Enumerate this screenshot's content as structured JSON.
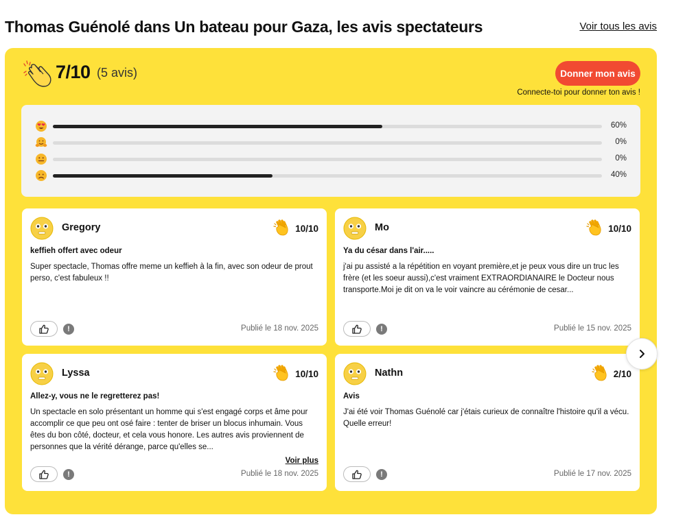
{
  "header": {
    "title": "Thomas Guénolé dans Un bateau pour Gaza, les avis spectateurs",
    "see_all": "Voir tous les avis"
  },
  "summary": {
    "score": "7/10",
    "count": "(5 avis)",
    "give_review": "Donner mon avis",
    "connect_note": "Connecte-toi pour donner ton avis !"
  },
  "distribution": [
    {
      "emoji": "heart-eyes-emoji",
      "percent": 60,
      "label": "60%"
    },
    {
      "emoji": "hugging-emoji",
      "percent": 0,
      "label": "0%"
    },
    {
      "emoji": "neutral-face-emoji",
      "percent": 0,
      "label": "0%"
    },
    {
      "emoji": "disappointed-face-emoji",
      "percent": 40,
      "label": "40%"
    }
  ],
  "reviews": [
    {
      "author": "Gregory",
      "rating": "10/10",
      "title": "keffieh offert avec odeur",
      "body": "Super spectacle, Thomas offre meme un keffieh à la fin, avec son odeur de prout perso, c'est fabuleux !!",
      "see_more": "",
      "date": "Publié le 18 nov. 2025"
    },
    {
      "author": "Mo",
      "rating": "10/10",
      "title": "Ya du césar dans l'air.....",
      "body": "j'ai pu assisté a la répétition en voyant première,et je peux vous dire un truc les frère (et les soeur aussi),c'est vraiment EXTRAORDIANAIRE le Docteur nous transporte.Moi je dit on va le voir vaincre au cérémonie de cesar...",
      "see_more": "",
      "date": "Publié le 15 nov. 2025"
    },
    {
      "author": "Lyssa",
      "rating": "10/10",
      "title": "Allez-y, vous ne le regretterez pas!",
      "body": "Un spectacle en solo présentant un homme qui s'est engagé corps et âme pour accomplir ce que peu ont osé faire : tenter de briser un blocus inhumain. Vous êtes du bon côté, docteur, et cela vous honore. Les autres avis proviennent de personnes que la vérité dérange, parce qu'elles se...",
      "see_more": "Voir plus",
      "date": "Publié le 18 nov. 2025"
    },
    {
      "author": "Nathn",
      "rating": "2/10",
      "title": "Avis",
      "body": "J'ai été voir Thomas Guénolé car j'étais curieux de connaître l'histoire qu'il a vécu. Quelle erreur!",
      "see_more": "",
      "date": "Publié le 17 nov. 2025"
    }
  ],
  "colors": {
    "panel": "#fee13a",
    "button": "#f14a32",
    "bar": "#222222",
    "track": "#dcdcdc"
  }
}
